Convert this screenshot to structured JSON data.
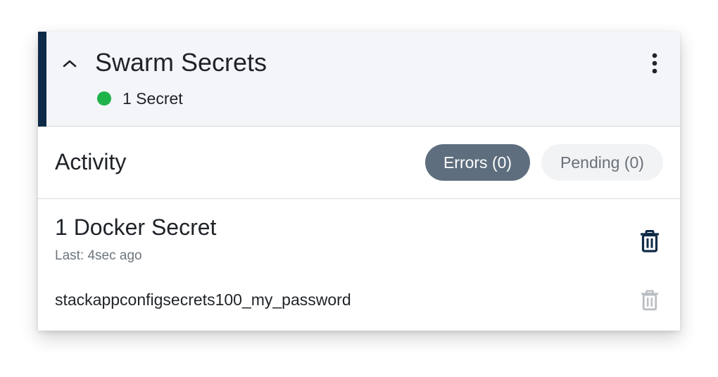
{
  "panel": {
    "title": "Swarm Secrets",
    "status_text": "1 Secret",
    "status_color": "#1fb34a",
    "accent_color": "#0e2a47"
  },
  "activity": {
    "title": "Activity",
    "tabs": [
      {
        "label": "Errors (0)",
        "selected": true
      },
      {
        "label": "Pending (0)",
        "selected": false
      }
    ]
  },
  "group": {
    "title": "1 Docker Secret",
    "subtitle": "Last: 4sec ago",
    "items": [
      {
        "name": "stackappconfigsecrets100_my_password"
      }
    ]
  },
  "icons": {
    "collapse": "chevron-up-icon",
    "menu": "more-vertical-icon",
    "delete_group": "trash-icon",
    "delete_item": "trash-icon"
  }
}
